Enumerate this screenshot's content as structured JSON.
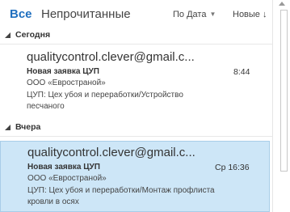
{
  "filters": {
    "all": "Все",
    "unread": "Непрочитанные",
    "sort_by": "По Дата",
    "order": "Новые ↓"
  },
  "groups": [
    {
      "label": "Сегодня"
    },
    {
      "label": "Вчера"
    }
  ],
  "messages": [
    {
      "sender": "qualitycontrol.clever@gmail.c...",
      "subject": "Новая заявка ЦУП",
      "company": "ООО «Евространой»",
      "time": "8:44",
      "preview": "ЦУП: Цех убоя и переработки/Устройство песчаного"
    },
    {
      "sender": "qualitycontrol.clever@gmail.c...",
      "subject": "Новая заявка ЦУП",
      "company": "ООО «Евространой»",
      "time": "Ср 16:36",
      "preview": "ЦУП: Цех убоя и переработки/Монтаж профлиста кровли в осях"
    }
  ]
}
